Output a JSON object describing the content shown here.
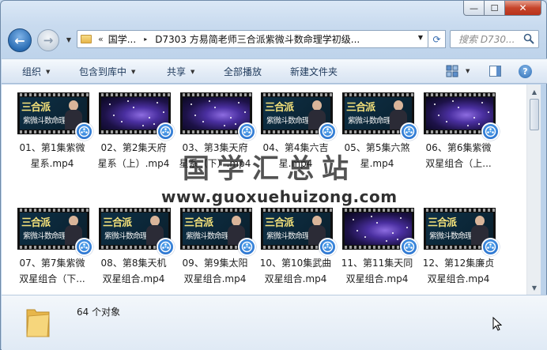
{
  "caption": {
    "minimize": "—",
    "maximize": "☐",
    "close": "✕"
  },
  "nav": {
    "back_glyph": "←",
    "forward_glyph": "→",
    "address_chevron": "«",
    "breadcrumb_root": "国学...",
    "breadcrumb_arrow": "▸",
    "path": "D7303 方易简老师三合派紫微斗数命理学初级...",
    "refresh_glyph": "⟳",
    "search_placeholder": "搜索 D730...",
    "dropdown_glyph": "▼"
  },
  "toolbar": {
    "organize": "组织",
    "include_in_library": "包含到库中",
    "share": "共享",
    "play_all": "全部播放",
    "new_folder": "新建文件夹",
    "help_glyph": "?"
  },
  "items": [
    {
      "line1": "01、第1集紫微",
      "line2": "星系.mp4",
      "thumb": "course"
    },
    {
      "line1": "02、第2集天府",
      "line2": "星系（上）.mp4",
      "thumb": "space"
    },
    {
      "line1": "03、第3集天府",
      "line2": "星系（下）.mp4",
      "thumb": "space"
    },
    {
      "line1": "04、第4集六吉",
      "line2": "星.mp4",
      "thumb": "course"
    },
    {
      "line1": "05、第5集六煞",
      "line2": "星.mp4",
      "thumb": "course"
    },
    {
      "line1": "06、第6集紫微",
      "line2": "双星组合（上...",
      "thumb": "space"
    },
    {
      "line1": "07、第7集紫微",
      "line2": "双星组合（下...",
      "thumb": "course"
    },
    {
      "line1": "08、第8集天机",
      "line2": "双星组合.mp4",
      "thumb": "course"
    },
    {
      "line1": "09、第9集太阳",
      "line2": "双星组合.mp4",
      "thumb": "course"
    },
    {
      "line1": "10、第10集武曲",
      "line2": "双星组合.mp4",
      "thumb": "course"
    },
    {
      "line1": "11、第11集天同",
      "line2": "双星组合.mp4",
      "thumb": "space"
    },
    {
      "line1": "12、第12集廉贞",
      "line2": "双星组合.mp4",
      "thumb": "course"
    }
  ],
  "thumb_text": {
    "title": "三合派",
    "subtitle": "紫微斗数命理学"
  },
  "watermark": {
    "cn": "国学汇总站",
    "url": "www.guoxuehuizong.com"
  },
  "status": {
    "count": "64 个对象"
  },
  "colors": {
    "accent": "#1e395b",
    "badge": "#1d62c4",
    "folder": "#e7b64a"
  }
}
